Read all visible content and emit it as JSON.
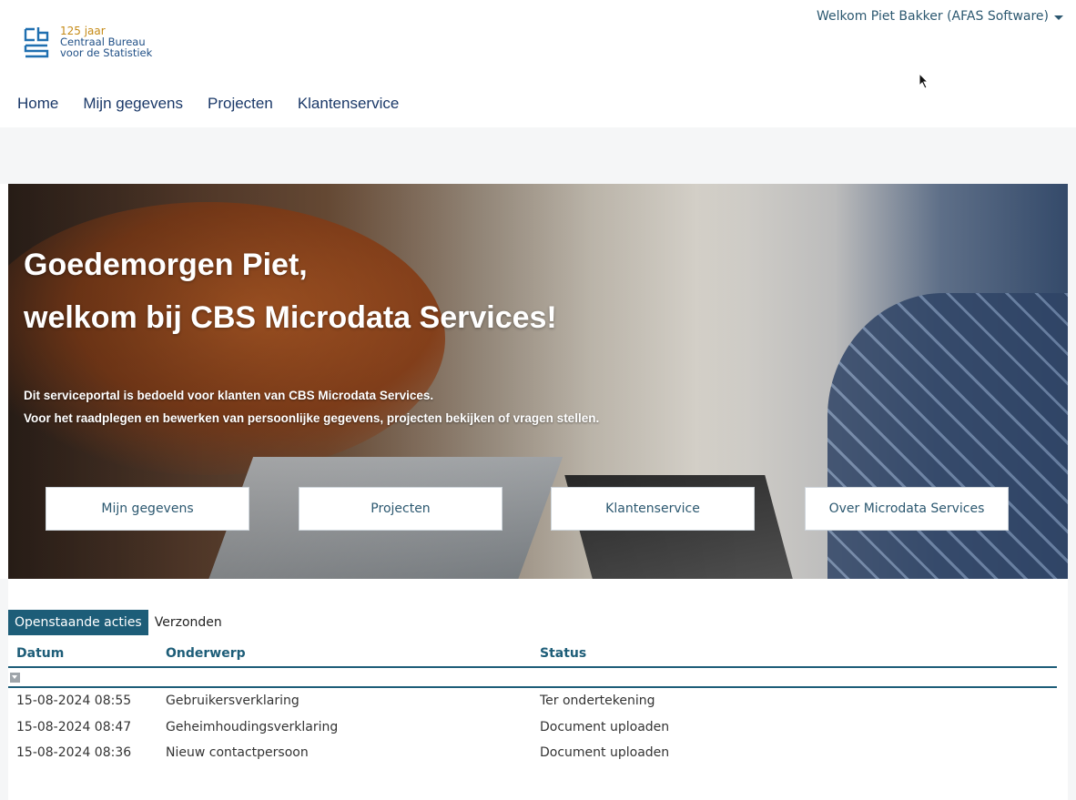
{
  "header": {
    "logo": {
      "years": "125 jaar",
      "line1": "Centraal Bureau",
      "line2": "voor de Statistiek",
      "icon": "cbs-logo-icon"
    },
    "welcome": "Welkom Piet Bakker (AFAS Software)"
  },
  "nav": [
    "Home",
    "Mijn gegevens",
    "Projecten",
    "Klantenservice"
  ],
  "hero": {
    "title_line1": "Goedemorgen Piet,",
    "title_line2": "welkom bij CBS Microdata Services!",
    "desc_line1": "Dit serviceportal is bedoeld voor klanten van CBS Microdata Services.",
    "desc_line2": "Voor het raadplegen en bewerken van persoonlijke gegevens, projecten bekijken of vragen stellen.",
    "buttons": [
      "Mijn gegevens",
      "Projecten",
      "Klantenservice",
      "Over Microdata Services"
    ]
  },
  "actions": {
    "tabs": [
      "Openstaande acties",
      "Verzonden"
    ],
    "columns": [
      "Datum",
      "Onderwerp",
      "Status"
    ],
    "rows": [
      {
        "datum": "15-08-2024 08:55",
        "onderwerp": "Gebruikersverklaring",
        "status": "Ter ondertekening"
      },
      {
        "datum": "15-08-2024 08:47",
        "onderwerp": "Geheimhoudingsverklaring",
        "status": "Document uploaden"
      },
      {
        "datum": "15-08-2024 08:36",
        "onderwerp": "Nieuw contactpersoon",
        "status": "Document uploaden"
      }
    ]
  },
  "colors": {
    "nav": "#1a3868",
    "accent": "#1d5d78",
    "logo_gold": "#c58a16",
    "logo_blue": "#1f4f86"
  }
}
